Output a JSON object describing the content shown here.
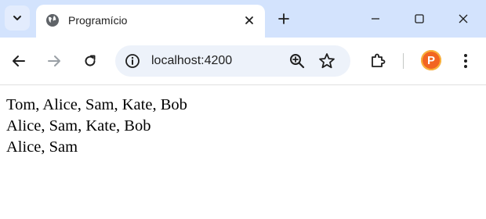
{
  "browser": {
    "tab": {
      "title": "Programício",
      "icon": "globe-icon"
    },
    "address_bar": {
      "url": "localhost:4200"
    },
    "colors": {
      "titlebar": "#d3e3fd",
      "omnibox": "#edf2fa",
      "profile": "#f26522"
    },
    "profile_initial": "P"
  },
  "page": {
    "lines": [
      "Tom, Alice, Sam, Kate, Bob",
      "Alice, Sam, Kate, Bob",
      "Alice, Sam"
    ]
  }
}
